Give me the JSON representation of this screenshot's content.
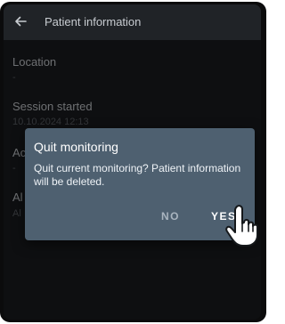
{
  "app_bar": {
    "title": "Patient information",
    "back_icon": "arrow-left-icon"
  },
  "fields": [
    {
      "label": "Location",
      "value": "-"
    },
    {
      "label": "Session started",
      "value": "10.10.2024 12:13"
    },
    {
      "label": "Ac",
      "value": "-"
    },
    {
      "label": "Al",
      "value": "Al"
    }
  ],
  "dialog": {
    "title": "Quit monitoring",
    "message": "Quit current monitoring? Patient information will be deleted.",
    "no_label": "NO",
    "yes_label": "YES"
  },
  "pointer_icon": "hand-pointer-icon"
}
